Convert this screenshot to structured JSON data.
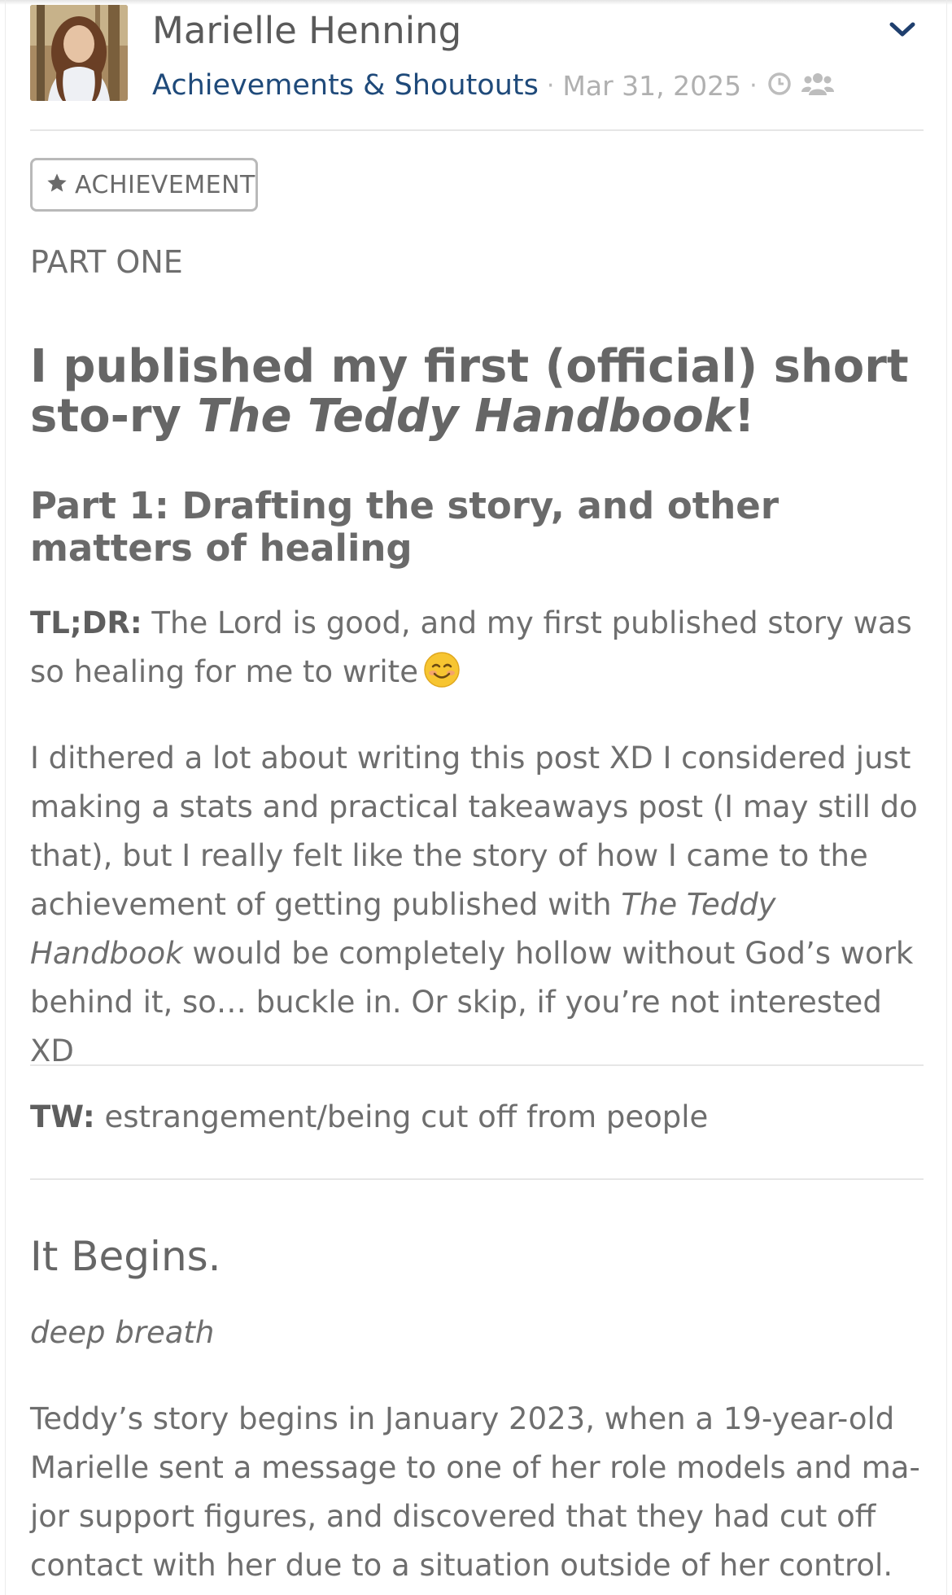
{
  "post": {
    "author_name": "Marielle Henning",
    "category": "Achievements & Shoutouts",
    "separator": "·",
    "date": "Mar 31, 2025",
    "meta_icons": [
      "clock-icon",
      "group-icon"
    ],
    "menu_icon": "chevron-down-icon"
  },
  "badge": {
    "icon": "star-icon",
    "label": "ACHIEVEMENT"
  },
  "content": {
    "part_label": "PART ONE",
    "title_prefix": "I published my first (official) short sto-ry ",
    "title_italic": "The Teddy Handbook",
    "title_suffix": "!",
    "subtitle": "Part 1: Drafting the story, and other matters of healing",
    "tldr_label": "TL;DR:",
    "tldr_text": " The Lord is good, and my first published story was so healing for me to write",
    "tldr_emoji": "smiling-face-emoji",
    "intro_part1": "I dithered a lot about writing this post XD I considered just making a stats and practical takeaways post (I may still do that), but I really felt like the story of how I came to the achievement of getting published with ",
    "intro_italic": "The Teddy Handbook",
    "intro_part2": " would be completely hollow without God’s work behind it, so… buckle in. Or skip, if you’re not interested XD",
    "tw_label": "TW:",
    "tw_text": " estrangement/being cut off from people",
    "section_heading": "It Begins.",
    "deep_breath": "deep breath",
    "story_text": "Teddy’s story begins in January 2023, when a 19-year-old Marielle sent a message to one of her role models and ma-jor support figures, and discovered that they had cut off contact with her due to a situation outside of her control."
  },
  "colors": {
    "link_blue": "#1f4a7a",
    "text_gray": "#6e6e6e",
    "meta_gray": "#b0b0b0",
    "divider": "#e6e6e6"
  }
}
